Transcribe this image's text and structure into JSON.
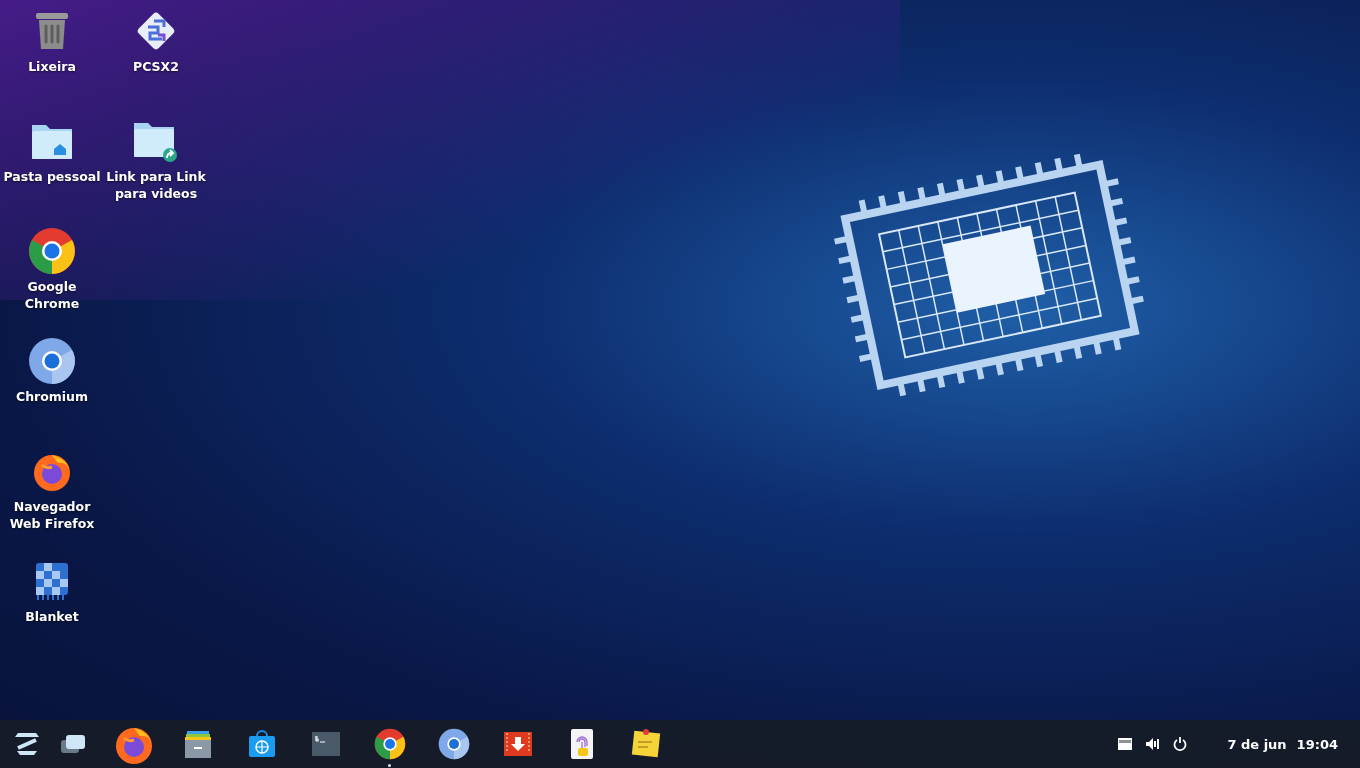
{
  "desktop_icons": [
    {
      "kind": "trash",
      "label": "Lixeira"
    },
    {
      "kind": "pcsx2",
      "label": "PCSX2"
    },
    {
      "kind": "home-folder",
      "label": "Pasta pessoal"
    },
    {
      "kind": "link-folder",
      "label": "Link para Link para videos"
    },
    {
      "kind": "chrome",
      "label": "Google Chrome"
    },
    {
      "kind": "chromium",
      "label": "Chromium"
    },
    {
      "kind": "firefox",
      "label": "Navegador Web Firefox"
    },
    {
      "kind": "blanket",
      "label": "Blanket"
    }
  ],
  "taskbar": {
    "apps": [
      {
        "kind": "zorin",
        "running": false
      },
      {
        "kind": "workspaces",
        "running": false
      },
      {
        "kind": "firefox",
        "running": false
      },
      {
        "kind": "files",
        "running": false
      },
      {
        "kind": "store",
        "running": false
      },
      {
        "kind": "terminal",
        "running": false
      },
      {
        "kind": "chrome",
        "running": true
      },
      {
        "kind": "chromium",
        "running": false
      },
      {
        "kind": "video",
        "running": false
      },
      {
        "kind": "fingerprint",
        "running": false
      },
      {
        "kind": "notes",
        "running": false
      }
    ],
    "tray": [
      {
        "kind": "network"
      },
      {
        "kind": "volume"
      },
      {
        "kind": "power"
      }
    ],
    "date": "7 de jun",
    "time": "19:04"
  }
}
